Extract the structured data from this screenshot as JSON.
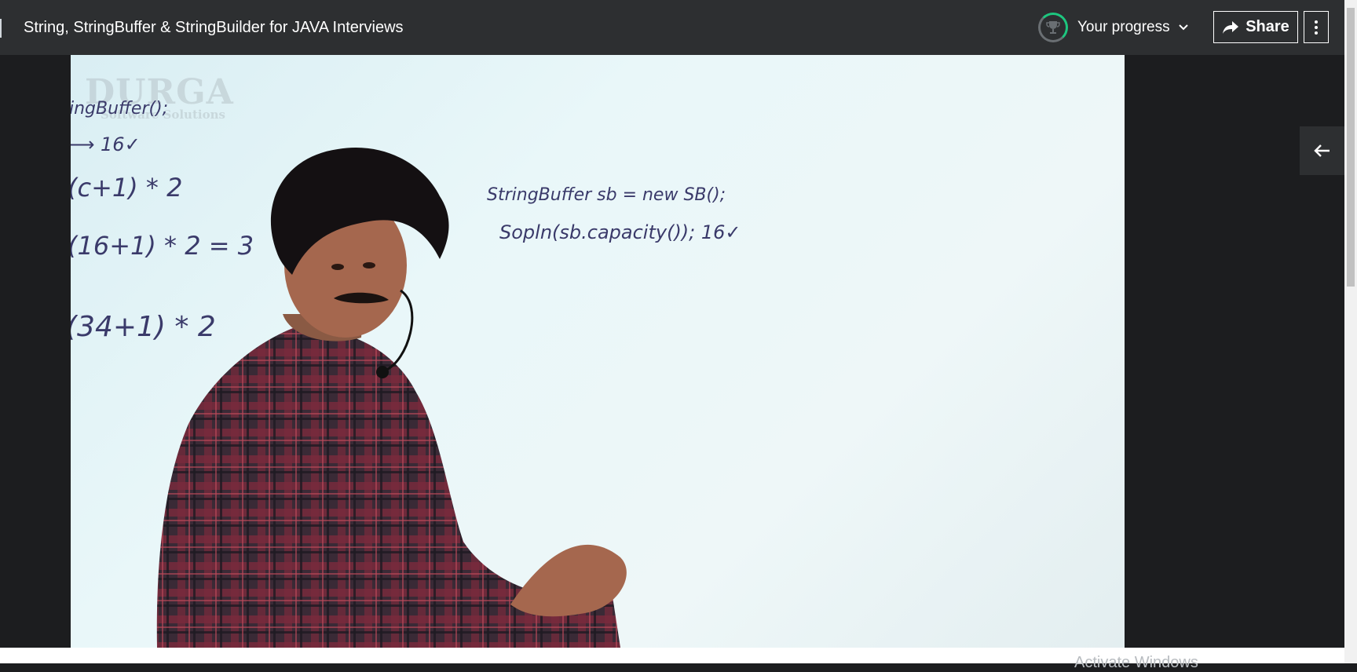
{
  "header": {
    "title": "String, StringBuffer & StringBuilder for JAVA Interviews",
    "progress_label": "Your progress",
    "share_label": "Share"
  },
  "icons": {
    "progress": "trophy-icon",
    "progress_dropdown": "chevron-down-icon",
    "share": "share-arrow-icon",
    "more": "vertical-ellipsis-icon",
    "sidebar_toggle": "arrow-left-icon"
  },
  "colors": {
    "topbar": "#2d2f31",
    "progress_ring": "#1dc77f",
    "page_background": "#1c1d1f"
  },
  "video": {
    "watermark_brand": "DURGA",
    "watermark_sub": "Software Solutions",
    "board": {
      "left_line1": "ingBuffer();",
      "left_line2": "⟶ 16✓",
      "left_line3": "(c+1) * 2",
      "left_line4": "(16+1) * 2 = 3",
      "left_line5": "(34+1) * 2",
      "right_line1": "StringBuffer sb = new SB();",
      "right_line2": "Sopln(sb.capacity()); 16✓"
    }
  },
  "os_overlay": {
    "text": "Activate Windows"
  }
}
